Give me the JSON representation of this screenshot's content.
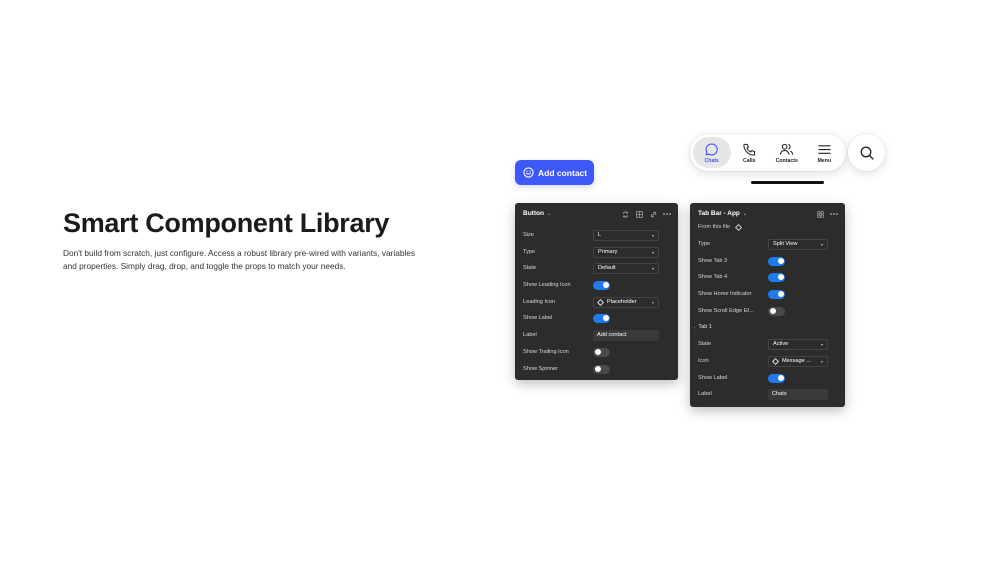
{
  "hero": {
    "title": "Smart Component Library",
    "description": "Don't build from scratch, just configure. Access a robust library pre-wired with variants, variables and properties. Simply drag, drop, and toggle the props to match your needs."
  },
  "add_button": {
    "label": "Add contact",
    "color": "#3c59f5"
  },
  "tabbar": {
    "tabs": [
      {
        "label": "Chats",
        "icon": "chat-bubble-icon",
        "active": true
      },
      {
        "label": "Calls",
        "icon": "phone-icon",
        "active": false
      },
      {
        "label": "Contacts",
        "icon": "contacts-icon",
        "active": false
      },
      {
        "label": "Menu",
        "icon": "menu-icon",
        "active": false
      }
    ],
    "search_icon": "search-icon"
  },
  "button_panel": {
    "title": "Button",
    "rows": [
      {
        "label": "Size",
        "value": "L"
      },
      {
        "label": "Type",
        "value": "Primary"
      },
      {
        "label": "State",
        "value": "Default"
      },
      {
        "label": "Show Leading Icon",
        "toggle": true
      },
      {
        "label": "Leading Icon",
        "value": "Placeholder"
      },
      {
        "label": "Show Label",
        "toggle": true
      },
      {
        "label": "Label",
        "value": "Add contact"
      },
      {
        "label": "Show Trailing Icon",
        "toggle": false
      },
      {
        "label": "Show Spinner",
        "toggle": false
      }
    ]
  },
  "tab_panel": {
    "title": "Tab Bar - App",
    "source": "From this file",
    "rows": [
      {
        "label": "Type",
        "value": "Split View"
      },
      {
        "label": "Show Tab 3",
        "toggle": true
      },
      {
        "label": "Show Tab 4",
        "toggle": true
      },
      {
        "label": "Show Home Indicator",
        "toggle": true
      },
      {
        "label": "Show Scroll Edge Ef...",
        "toggle": false
      }
    ],
    "section": "Tab 1",
    "section_rows": [
      {
        "label": "State",
        "value": "Active"
      },
      {
        "label": "Icon",
        "value": "Message ..."
      },
      {
        "label": "Show Label",
        "toggle": true
      },
      {
        "label": "Label",
        "value": "Chats"
      }
    ]
  }
}
